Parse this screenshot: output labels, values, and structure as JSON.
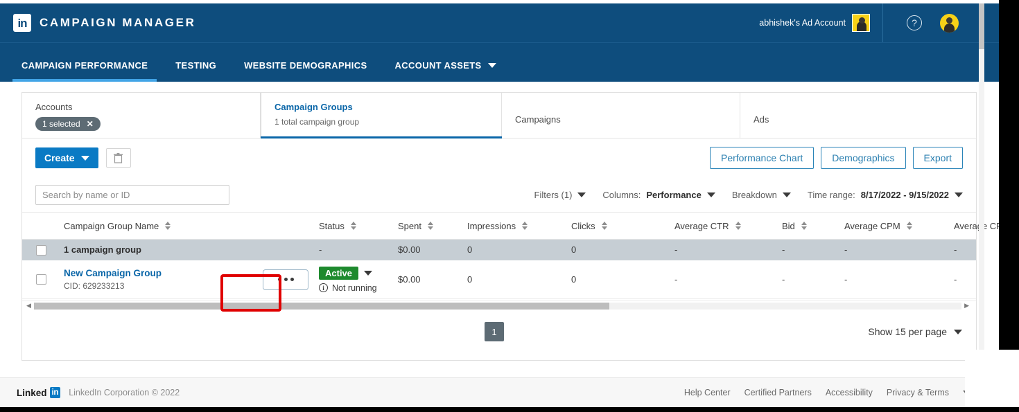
{
  "topbar": {
    "logo_text": "in",
    "brand_title": "CAMPAIGN MANAGER",
    "account_name": "abhishek's Ad Account",
    "help_label": "?"
  },
  "nav": {
    "items": [
      {
        "label": "CAMPAIGN PERFORMANCE",
        "active": true,
        "caret": false
      },
      {
        "label": "TESTING",
        "active": false,
        "caret": false
      },
      {
        "label": "WEBSITE DEMOGRAPHICS",
        "active": false,
        "caret": false
      },
      {
        "label": "ACCOUNT ASSETS",
        "active": false,
        "caret": true
      }
    ]
  },
  "tabs": [
    {
      "label": "Accounts",
      "chip": "1 selected",
      "chip_close": "✕",
      "selected": false
    },
    {
      "label": "Campaign Groups",
      "sub": "1 total campaign group",
      "selected": true
    },
    {
      "label": "Campaigns",
      "selected": false
    },
    {
      "label": "Ads",
      "selected": false
    }
  ],
  "toolbar": {
    "create_label": "Create",
    "delete_icon": "trash-icon",
    "performance_chart_label": "Performance Chart",
    "demographics_label": "Demographics",
    "export_label": "Export"
  },
  "filters": {
    "search_placeholder": "Search by name or ID",
    "search_value": "",
    "filters_label": "Filters (1)",
    "columns_label": "Columns:",
    "columns_value": "Performance",
    "breakdown_label": "Breakdown",
    "timerange_label": "Time range:",
    "timerange_value": "8/17/2022 - 9/15/2022"
  },
  "table": {
    "columns": [
      "Campaign Group Name",
      "Status",
      "Spent",
      "Impressions",
      "Clicks",
      "Average CTR",
      "Bid",
      "Average CPM",
      "Average CPC"
    ],
    "summary_row": {
      "name": "1 campaign group",
      "status": "-",
      "spent": "$0.00",
      "impressions": "0",
      "clicks": "0",
      "avg_ctr": "-",
      "bid": "-",
      "avg_cpm": "-",
      "avg_cpc": "-"
    },
    "rows": [
      {
        "name": "New Campaign Group",
        "cid": "CID: 629233213",
        "actions_label": "•••",
        "status_badge": "Active",
        "status_note": "Not running",
        "spent": "$0.00",
        "impressions": "0",
        "clicks": "0",
        "avg_ctr": "-",
        "bid": "-",
        "avg_cpm": "-",
        "avg_cpc": "-"
      }
    ]
  },
  "pager": {
    "current_page": "1",
    "per_page_label": "Show 15 per page"
  },
  "footer": {
    "linked": "Linked",
    "in": "in",
    "copyright": "LinkedIn Corporation © 2022",
    "links": [
      "Help Center",
      "Certified Partners",
      "Accessibility",
      "Privacy & Terms"
    ]
  },
  "colors": {
    "header_blue": "#0e4d7d",
    "accent_blue": "#0a7ac4",
    "link_blue": "#0a66a8",
    "active_green": "#1e8a2e",
    "highlight_red": "#e00000",
    "summary_gray": "#c6ced4"
  }
}
